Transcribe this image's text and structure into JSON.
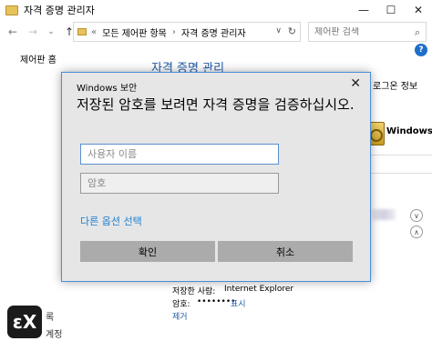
{
  "window": {
    "title": "자격 증명 관리자",
    "minimize": "—",
    "maximize": "☐",
    "close": "✕"
  },
  "address": {
    "back": "←",
    "forward": "→",
    "recent": "⌄",
    "up": "↑",
    "overflow": "«",
    "crumbs": [
      "모든 제어판 항목",
      "자격 증명 관리자"
    ],
    "separator": "›",
    "dropdown": "∨",
    "refresh": "↻"
  },
  "search": {
    "placeholder": "제어판 검색",
    "icon": "search-icon"
  },
  "left_nav": {
    "home": "제어판 홈"
  },
  "help": {
    "label": "?"
  },
  "page": {
    "heading": "자격 증명 관리"
  },
  "right_panel": {
    "windows_credentials": "로그온 정보",
    "vault_label": "Windows",
    "expand_down": "∨",
    "collapse_up": "∧"
  },
  "details": {
    "saved_by_label": "저장한 사람:",
    "saved_by_value": "Internet Explorer",
    "password_label": "암호:",
    "password_value": "••••••••",
    "show_link": "표시",
    "remove_link": "제거"
  },
  "bottom": {
    "logo_text": "ɛX",
    "text_1": "록",
    "text_2": "계정"
  },
  "dialog": {
    "title": "Windows 보안",
    "close": "✕",
    "prompt": "저장된 암호를 보려면 자격 증명을 검증하십시오.",
    "username_placeholder": "사용자 이름",
    "password_placeholder": "암호",
    "more_options": "다른 옵션 선택",
    "ok": "확인",
    "cancel": "취소"
  }
}
